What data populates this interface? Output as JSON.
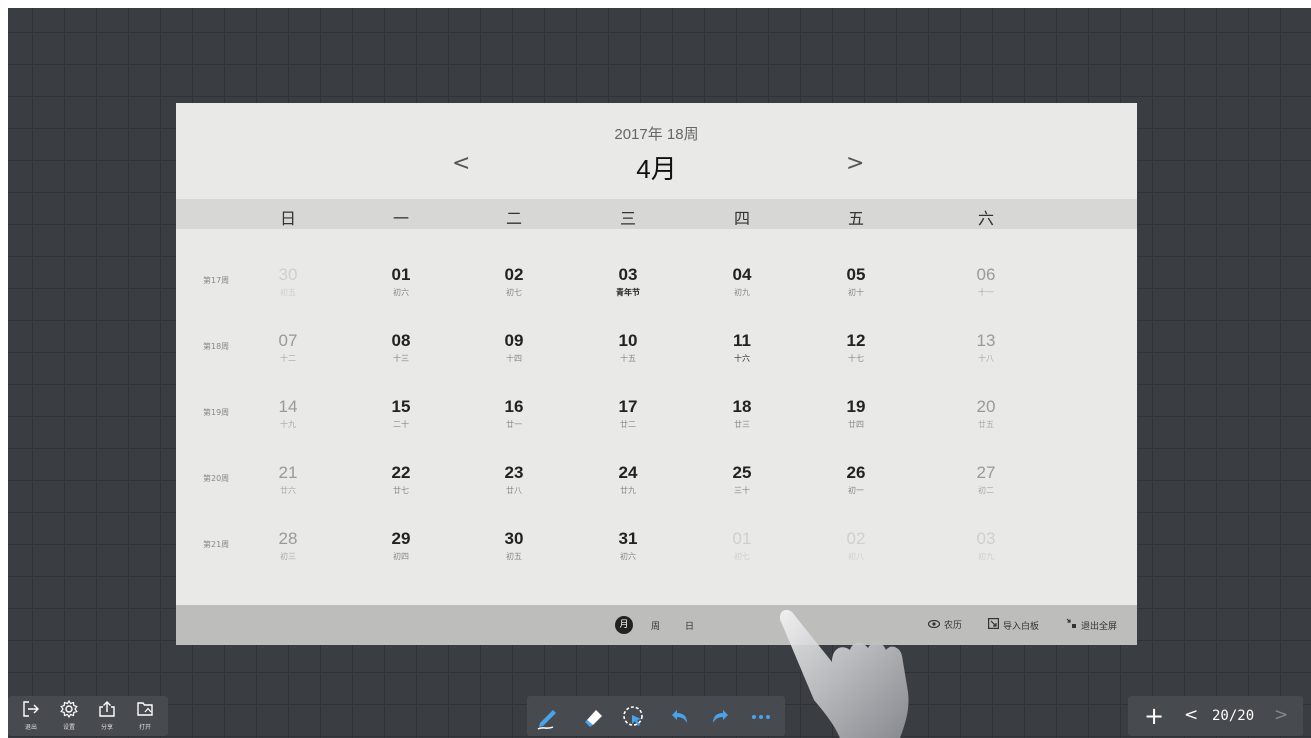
{
  "calendar": {
    "year_week": "2017年  18周",
    "month": "4月",
    "nav_prev": "<",
    "nav_next": ">",
    "weekdays": [
      "日",
      "一",
      "二",
      "三",
      "四",
      "五",
      "六"
    ],
    "weeks": [
      {
        "label": "第17周",
        "days": [
          {
            "num": "30",
            "lunar": "初五"
          },
          {
            "num": "01",
            "lunar": "初六"
          },
          {
            "num": "02",
            "lunar": "初七"
          },
          {
            "num": "03",
            "lunar": "青年节"
          },
          {
            "num": "04",
            "lunar": "初九"
          },
          {
            "num": "05",
            "lunar": "初十"
          },
          {
            "num": "06",
            "lunar": "十一"
          }
        ]
      },
      {
        "label": "第18周",
        "days": [
          {
            "num": "07",
            "lunar": "十二"
          },
          {
            "num": "08",
            "lunar": "十三"
          },
          {
            "num": "09",
            "lunar": "十四"
          },
          {
            "num": "10",
            "lunar": "十五"
          },
          {
            "num": "11",
            "lunar": "十六"
          },
          {
            "num": "12",
            "lunar": "十七"
          },
          {
            "num": "13",
            "lunar": "十八"
          }
        ]
      },
      {
        "label": "第19周",
        "days": [
          {
            "num": "14",
            "lunar": "十九"
          },
          {
            "num": "15",
            "lunar": "二十"
          },
          {
            "num": "16",
            "lunar": "廿一"
          },
          {
            "num": "17",
            "lunar": "廿二"
          },
          {
            "num": "18",
            "lunar": "廿三"
          },
          {
            "num": "19",
            "lunar": "廿四"
          },
          {
            "num": "20",
            "lunar": "廿五"
          }
        ]
      },
      {
        "label": "第20周",
        "days": [
          {
            "num": "21",
            "lunar": "廿六"
          },
          {
            "num": "22",
            "lunar": "廿七"
          },
          {
            "num": "23",
            "lunar": "廿八"
          },
          {
            "num": "24",
            "lunar": "廿九"
          },
          {
            "num": "25",
            "lunar": "三十"
          },
          {
            "num": "26",
            "lunar": "初一"
          },
          {
            "num": "27",
            "lunar": "初二"
          }
        ]
      },
      {
        "label": "第21周",
        "days": [
          {
            "num": "28",
            "lunar": "初三"
          },
          {
            "num": "29",
            "lunar": "初四"
          },
          {
            "num": "30",
            "lunar": "初五"
          },
          {
            "num": "31",
            "lunar": "初六"
          },
          {
            "num": "01",
            "lunar": "初七"
          },
          {
            "num": "02",
            "lunar": "初八"
          },
          {
            "num": "03",
            "lunar": "初九"
          }
        ]
      }
    ],
    "footer": {
      "view_month": "月",
      "view_week": "周",
      "view_day": "日",
      "lunar_toggle": "农历",
      "import_whiteboard": "导入白板",
      "exit_fullscreen": "退出全屏"
    }
  },
  "left_toolbar": [
    {
      "label": "退出",
      "icon": "exit-icon"
    },
    {
      "label": "设置",
      "icon": "gear-icon"
    },
    {
      "label": "分享",
      "icon": "share-icon"
    },
    {
      "label": "打开",
      "icon": "folder-icon"
    }
  ],
  "center_toolbar": {
    "tools": [
      "pen-icon",
      "eraser-icon",
      "lasso-select-icon",
      "undo-icon",
      "redo-icon",
      "more-icon"
    ],
    "accent_color": "#4aa3e8"
  },
  "right_toolbar": {
    "add": "+",
    "prev": "<",
    "page": "20/20",
    "next": ">"
  }
}
